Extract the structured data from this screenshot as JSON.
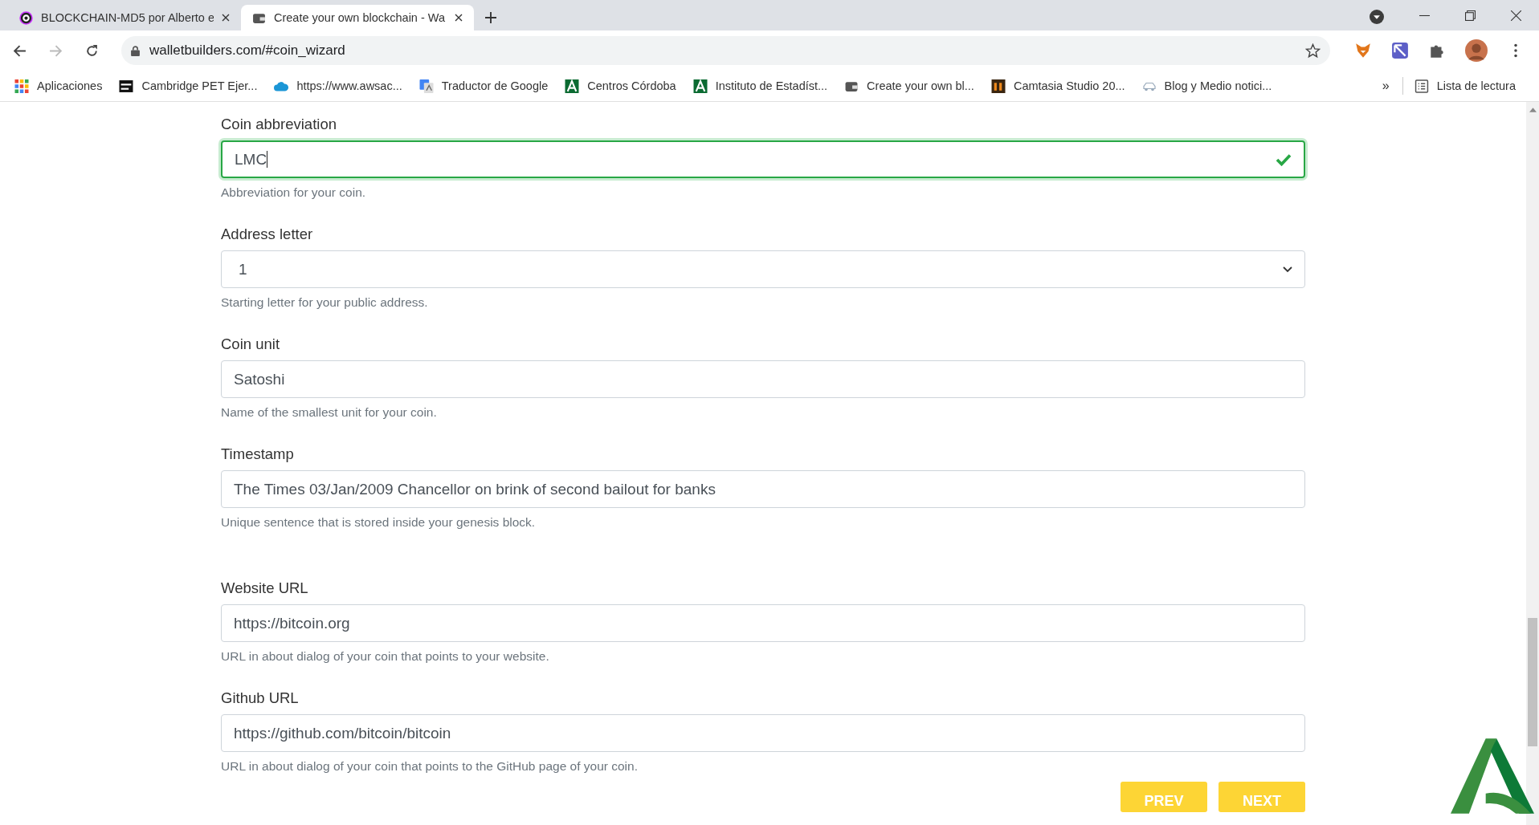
{
  "browser": {
    "tabs": [
      {
        "title": "BLOCKCHAIN-MD5 por Alberto e",
        "selected": false
      },
      {
        "title": "Create your own blockchain - Wa",
        "selected": true
      }
    ],
    "url": "walletbuilders.com/#coin_wizard",
    "bookmarks": [
      {
        "label": "Aplicaciones"
      },
      {
        "label": "Cambridge PET Ejer..."
      },
      {
        "label": "https://www.awsac..."
      },
      {
        "label": "Traductor de Google"
      },
      {
        "label": "Centros Córdoba"
      },
      {
        "label": "Instituto de Estadíst..."
      },
      {
        "label": "Create your own bl..."
      },
      {
        "label": "Camtasia Studio 20..."
      },
      {
        "label": "Blog y Medio notici..."
      }
    ],
    "more": "»",
    "reading_list": "Lista de lectura"
  },
  "form": {
    "sections": [
      {
        "fields": [
          {
            "label": "Coin abbreviation",
            "kind": "text",
            "value": "LMC",
            "valid": true,
            "help": "Abbreviation for your coin."
          },
          {
            "label": "Address letter",
            "kind": "select",
            "value": "1",
            "valid": false,
            "help": "Starting letter for your public address."
          },
          {
            "label": "Coin unit",
            "kind": "text",
            "value": "Satoshi",
            "valid": false,
            "help": "Name of the smallest unit for your coin."
          },
          {
            "label": "Timestamp",
            "kind": "text",
            "value": "The Times 03/Jan/2009 Chancellor on brink of second bailout for banks",
            "valid": false,
            "help": "Unique sentence that is stored inside your genesis block."
          }
        ]
      },
      {
        "fields": [
          {
            "label": "Website URL",
            "kind": "text",
            "value": "https://bitcoin.org",
            "valid": false,
            "help": "URL in about dialog of your coin that points to your website."
          },
          {
            "label": "Github URL",
            "kind": "text",
            "value": "https://github.com/bitcoin/bitcoin",
            "valid": false,
            "help": "URL in about dialog of your coin that points to the GitHub page of your coin."
          }
        ]
      }
    ],
    "buttons": [
      "PREV",
      "NEXT"
    ]
  }
}
